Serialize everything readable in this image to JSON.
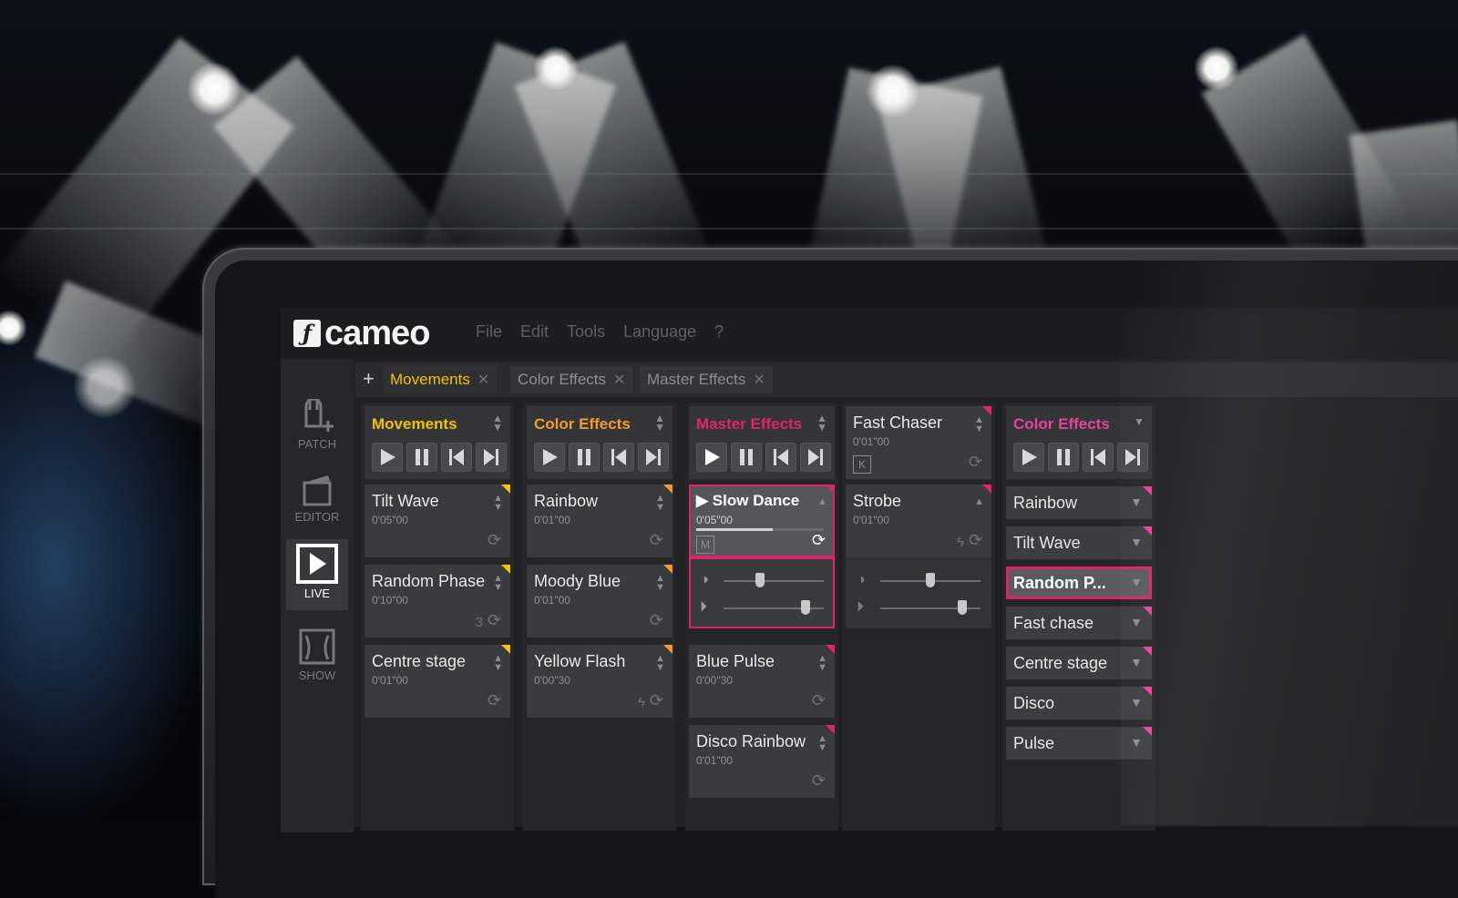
{
  "menu": {
    "logo_text": "cameo",
    "items": [
      "File",
      "Edit",
      "Tools",
      "Language",
      "?"
    ]
  },
  "sidebar": {
    "items": [
      {
        "label": "PATCH",
        "icon": "patch-icon",
        "active": false
      },
      {
        "label": "EDITOR",
        "icon": "editor-icon",
        "active": false
      },
      {
        "label": "LIVE",
        "icon": "play-icon",
        "active": true
      },
      {
        "label": "SHOW",
        "icon": "show-icon",
        "active": false
      }
    ]
  },
  "tabs": {
    "add_label": "+",
    "items": [
      {
        "label": "Movements",
        "active": true
      },
      {
        "label": "Color Effects",
        "active": false
      },
      {
        "label": "Master Effects",
        "active": false
      }
    ]
  },
  "colors": {
    "yellow": "#f2c100",
    "orange": "#f29a2e",
    "magenta": "#e0246b",
    "pink": "#e6449a"
  },
  "columns": [
    {
      "title": "Movements",
      "cues": [
        {
          "name": "Tilt Wave",
          "time": "0'05\"00"
        },
        {
          "name": "Random Phase",
          "time": "0'10\"00",
          "count": "3"
        },
        {
          "name": "Centre stage",
          "time": "0'01\"00"
        }
      ]
    },
    {
      "title": "Color Effects",
      "cues": [
        {
          "name": "Rainbow",
          "time": "0'01\"00"
        },
        {
          "name": "Moody Blue",
          "time": "0'01\"00"
        },
        {
          "name": "Yellow Flash",
          "time": "0'00\"30"
        }
      ]
    },
    {
      "title": "Master Effects",
      "active_cue": {
        "name": "Slow Dance",
        "time": "0'05\"00",
        "badge": "M",
        "progress": 0.6
      },
      "sliders": {
        "dimmer": 0.35,
        "speed": 0.85
      },
      "cues": [
        {
          "name": "Blue Pulse",
          "time": "0'00\"30"
        },
        {
          "name": "Disco Rainbow",
          "time": "0'01\"00"
        }
      ]
    },
    {
      "head": {
        "name": "Fast Chaser",
        "time": "0'01\"00",
        "badge": "K"
      },
      "cue": {
        "name": "Strobe",
        "time": "0'01\"00"
      },
      "sliders": {
        "dimmer": 0.5,
        "speed": 0.85
      }
    },
    {
      "title": "Color Effects",
      "list": [
        "Rainbow",
        "Tilt Wave",
        "Random P...",
        "Fast chase",
        "Centre stage",
        "Disco",
        "Pulse"
      ],
      "active_index": 2
    }
  ]
}
